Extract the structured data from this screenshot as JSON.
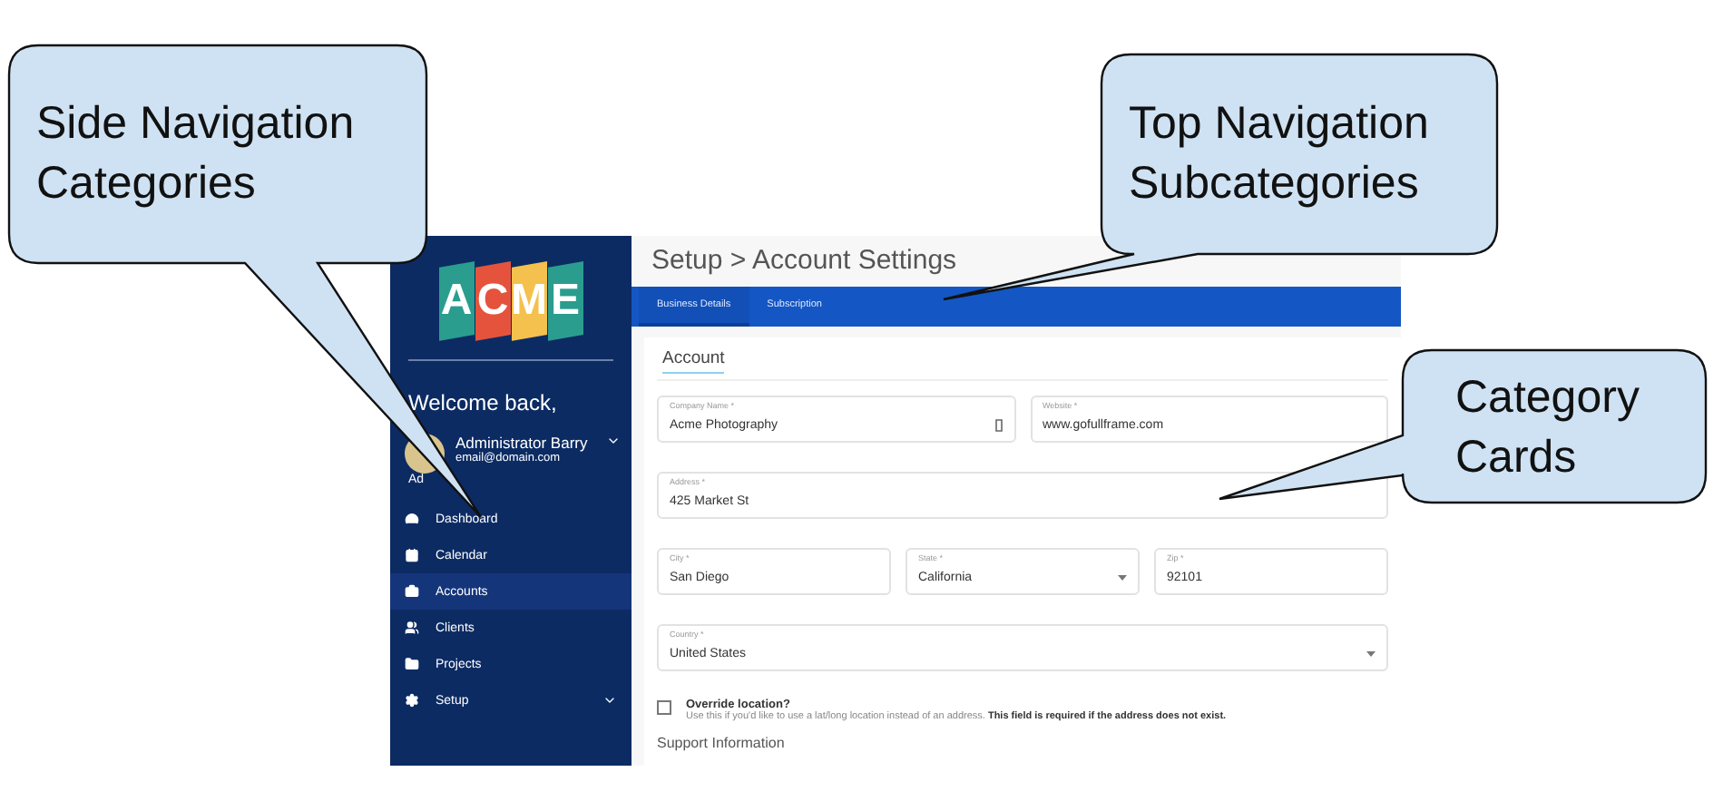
{
  "callouts": [
    {
      "text": "Side Navigation Categories"
    },
    {
      "text": "Top Navigation Subcategories"
    },
    {
      "text": "Category Cards"
    }
  ],
  "sidebar": {
    "logo": [
      {
        "letter": "A",
        "color": "#2a9d8f"
      },
      {
        "letter": "C",
        "color": "#e5533d"
      },
      {
        "letter": "M",
        "color": "#f4c04e"
      },
      {
        "letter": "E",
        "color": "#2a9d8f"
      }
    ],
    "welcome": "Welcome back,",
    "user": {
      "name": "Administrator Barry",
      "email": "email@domain.com",
      "role": "Ad"
    },
    "items": [
      {
        "label": "Dashboard",
        "selected": false,
        "expandable": false
      },
      {
        "label": "Calendar",
        "selected": false,
        "expandable": false
      },
      {
        "label": "Accounts",
        "selected": true,
        "expandable": false
      },
      {
        "label": "Clients",
        "selected": false,
        "expandable": false
      },
      {
        "label": "Projects",
        "selected": false,
        "expandable": false
      },
      {
        "label": "Setup",
        "selected": false,
        "expandable": true
      }
    ]
  },
  "page_title": "Setup > Account Settings",
  "tabs": [
    {
      "label": "Business Details",
      "selected": true
    },
    {
      "label": "Subscription",
      "selected": false
    }
  ],
  "card": {
    "title": "Account",
    "rows": [
      [
        {
          "label": "Company Name *",
          "value": "Acme Photography",
          "kind": "text",
          "icon": true
        },
        {
          "label": "Website *",
          "value": "www.gofullframe.com",
          "kind": "text"
        }
      ],
      [
        {
          "label": "Address *",
          "value": "425 Market St",
          "kind": "text"
        }
      ],
      [
        {
          "label": "City *",
          "value": "San Diego",
          "kind": "text"
        },
        {
          "label": "State *",
          "value": "California",
          "kind": "select"
        },
        {
          "label": "Zip *",
          "value": "92101",
          "kind": "text"
        }
      ],
      [
        {
          "label": "Country *",
          "value": "United States",
          "kind": "select"
        }
      ]
    ],
    "override": {
      "label": "Override location?",
      "checked": false,
      "help": "Use this if you'd like to use a lat/long location instead of an address. **This field is required if the address does not exist.**"
    },
    "next_section": "Support Information"
  }
}
